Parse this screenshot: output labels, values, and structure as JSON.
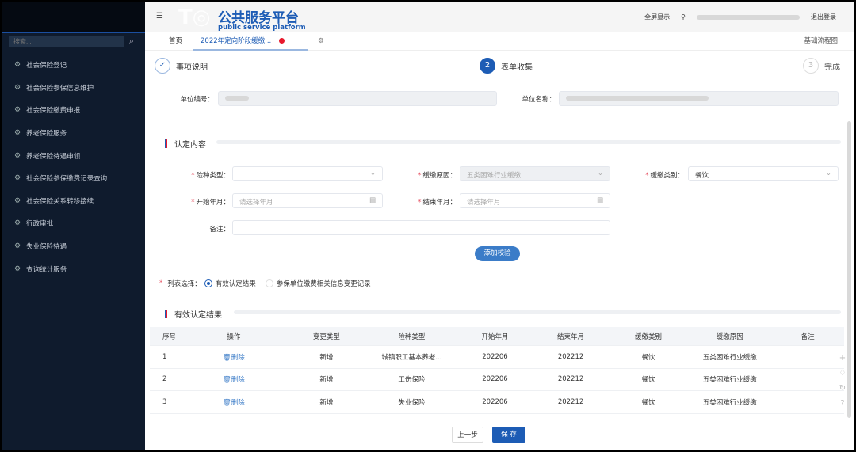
{
  "header": {
    "title": "公共服务平台",
    "subtitle": "public service platform",
    "fullscreen": "全屏显示",
    "logout": "退出登录"
  },
  "sidebar": {
    "search_placeholder": "搜索...",
    "items": [
      {
        "label": "社会保险登记"
      },
      {
        "label": "社会保险参保信息维护"
      },
      {
        "label": "社会保险缴费申报"
      },
      {
        "label": "养老保险服务"
      },
      {
        "label": "养老保险待遇申领"
      },
      {
        "label": "社会保险参保缴费记录查询"
      },
      {
        "label": "社会保险关系转移接续"
      },
      {
        "label": "行政审批"
      },
      {
        "label": "失业保险待遇"
      },
      {
        "label": "查询统计服务"
      }
    ]
  },
  "tabs": {
    "home": "首页",
    "active": "2022年定向阶段缓缴...",
    "flowchart": "基础流程图"
  },
  "steps": [
    {
      "num": "✓",
      "label": "事项说明"
    },
    {
      "num": "2",
      "label": "表单收集"
    },
    {
      "num": "3",
      "label": "完成"
    }
  ],
  "unit": {
    "code_label": "单位编号：",
    "name_label": "单位名称："
  },
  "section1": "认定内容",
  "form": {
    "insurance_type": {
      "label": "险种类型：",
      "value": ""
    },
    "reason": {
      "label": "缓缴原因：",
      "value": "五类困难行业缓缴"
    },
    "category": {
      "label": "缓缴类别：",
      "value": "餐饮"
    },
    "start": {
      "label": "开始年月：",
      "placeholder": "请选择年月"
    },
    "end": {
      "label": "结束年月：",
      "placeholder": "请选择年月"
    },
    "note": {
      "label": "备注：",
      "value": ""
    },
    "add_button": "添加校验",
    "list_label": "列表选择：",
    "radio1": "有效认定结果",
    "radio2": "参保单位缴费相关信息变更记录",
    "radio_selected": "有效认定结果"
  },
  "section2": "有效认定结果",
  "table": {
    "headers": [
      "序号",
      "操作",
      "变更类型",
      "险种类型",
      "开始年月",
      "结束年月",
      "缓缴类别",
      "缓缴原因",
      "备注"
    ],
    "rows": [
      [
        "1",
        "删除",
        "新增",
        "城镇职工基本养老...",
        "202206",
        "202212",
        "餐饮",
        "五类困难行业缓缴",
        ""
      ],
      [
        "2",
        "删除",
        "新增",
        "工伤保险",
        "202206",
        "202212",
        "餐饮",
        "五类困难行业缓缴",
        ""
      ],
      [
        "3",
        "删除",
        "新增",
        "失业保险",
        "202206",
        "202212",
        "餐饮",
        "五类困难行业缓缴",
        ""
      ]
    ]
  },
  "footer": {
    "prev": "上一步",
    "save": "保 存"
  },
  "colors": {
    "primary": "#1d5cb5",
    "sidebar": "#0f1b2d",
    "button": "#3b7cc8",
    "close": "#e8192c"
  }
}
